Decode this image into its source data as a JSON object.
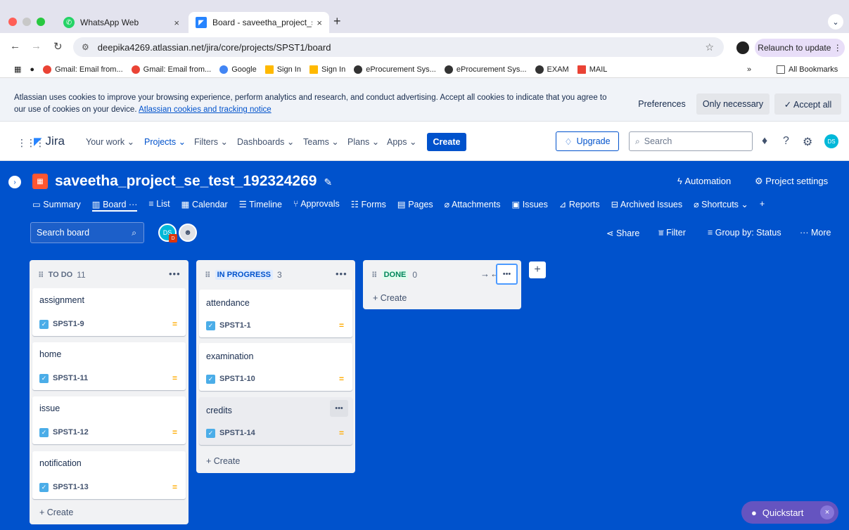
{
  "browser": {
    "tabs": [
      {
        "label": "WhatsApp Web",
        "close": "×",
        "icon": "whatsapp-icon"
      },
      {
        "label": "Board - saveetha_project_se",
        "close": "×",
        "icon": "jira-icon"
      }
    ],
    "new_tab": "+",
    "tab_menu": "⌄",
    "url": "deepika4269.atlassian.net/jira/core/projects/SPST1/board",
    "relaunch": "Relaunch to update ⋮",
    "bookmarks": [
      {
        "label": "Gmail: Email from...",
        "color": "#ea4335"
      },
      {
        "label": "Gmail: Email from...",
        "color": "#ea4335"
      },
      {
        "label": "Google",
        "color": "#4285f4"
      },
      {
        "label": "Sign In",
        "color": "#ffb900"
      },
      {
        "label": "Sign In",
        "color": "#ffb900"
      },
      {
        "label": "eProcurement Sys...",
        "color": "#333333"
      },
      {
        "label": "eProcurement Sys...",
        "color": "#333333"
      },
      {
        "label": "EXAM",
        "color": "#333333"
      },
      {
        "label": "MAIL",
        "color": "#ea4335"
      }
    ],
    "bookmarks_more": "»",
    "all_bookmarks": "All Bookmarks"
  },
  "cookie": {
    "message": "Atlassian uses cookies to improve your browsing experience, perform analytics and research, and conduct advertising. Accept all cookies to indicate that you agree to our use of cookies on your device.",
    "link": "Atlassian cookies and tracking notice",
    "preferences": "Preferences",
    "only_necessary": "Only necessary",
    "accept_all": "✓  Accept all"
  },
  "jira_nav": {
    "logo": "Jira",
    "items": [
      "Your work ⌄",
      "Projects ⌄",
      "Filters ⌄",
      "Dashboards ⌄",
      "Teams ⌄",
      "Plans ⌄",
      "Apps ⌄"
    ],
    "create": "Create",
    "upgrade": "Upgrade",
    "search_placeholder": "Search",
    "user_initials": "DS"
  },
  "project": {
    "title": "saveetha_project_se_test_192324269",
    "automation": "Automation",
    "settings": "Project settings",
    "tabs": [
      "Summary",
      "Board ···",
      "List",
      "Calendar",
      "Timeline",
      "Approvals",
      "Forms",
      "Pages",
      "Attachments",
      "Issues",
      "Reports",
      "Archived Issues",
      "Shortcuts ⌄",
      "+"
    ]
  },
  "toolbar": {
    "search_placeholder": "Search board",
    "avatar_initials": "DS",
    "avatar_badge": "D",
    "share": "Share",
    "filter": "Filter",
    "group_by": "Group by: Status",
    "more": "··· More"
  },
  "columns": [
    {
      "name": "TO DO",
      "count": "11",
      "cards": [
        {
          "title": "assignment",
          "key": "SPST1-9"
        },
        {
          "title": "home",
          "key": "SPST1-11"
        },
        {
          "title": "issue",
          "key": "SPST1-12"
        },
        {
          "title": "notification",
          "key": "SPST1-13"
        }
      ],
      "create": "+  Create"
    },
    {
      "name": "IN PROGRESS",
      "count": "3",
      "cards": [
        {
          "title": "attendance",
          "key": "SPST1-1"
        },
        {
          "title": "examination",
          "key": "SPST1-10"
        },
        {
          "title": "credits",
          "key": "SPST1-14"
        }
      ],
      "create": "+  Create"
    },
    {
      "name": "DONE",
      "count": "0",
      "cards": [],
      "create": "+  Create"
    }
  ],
  "quickstart": "Quickstart",
  "colors": {
    "brand": "#0052cc",
    "todo": "#5e6c84",
    "inprogress": "#0052cc",
    "done": "#00875a",
    "priority": "#ffab00"
  }
}
